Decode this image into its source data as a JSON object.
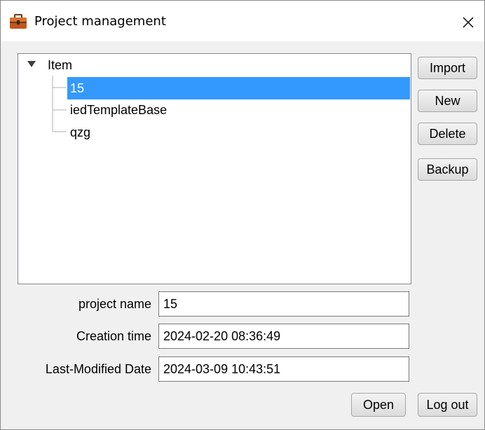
{
  "window": {
    "title": "Project management",
    "icon": "briefcase-icon",
    "close_glyph": "✕"
  },
  "tree": {
    "root_label": "Item",
    "expanded": true,
    "children": [
      "15",
      "iedTemplateBase",
      "qzg"
    ],
    "selected_index": 0
  },
  "side_buttons": {
    "import_label": "Import",
    "new_label": "New",
    "delete_label": "Delete",
    "backup_label": "Backup"
  },
  "fields": {
    "project_name_label": "project name",
    "project_name_value": "15",
    "creation_time_label": "Creation time",
    "creation_time_value": "2024-02-20 08:36:49",
    "last_modified_label": "Last-Modified Date",
    "last_modified_value": "2024-03-09 10:43:51"
  },
  "bottom_buttons": {
    "open_label": "Open",
    "logout_label": "Log out"
  },
  "colors": {
    "selection": "#3399ff",
    "window_bg": "#f0f0f0",
    "icon_brown": "#c0561f"
  }
}
